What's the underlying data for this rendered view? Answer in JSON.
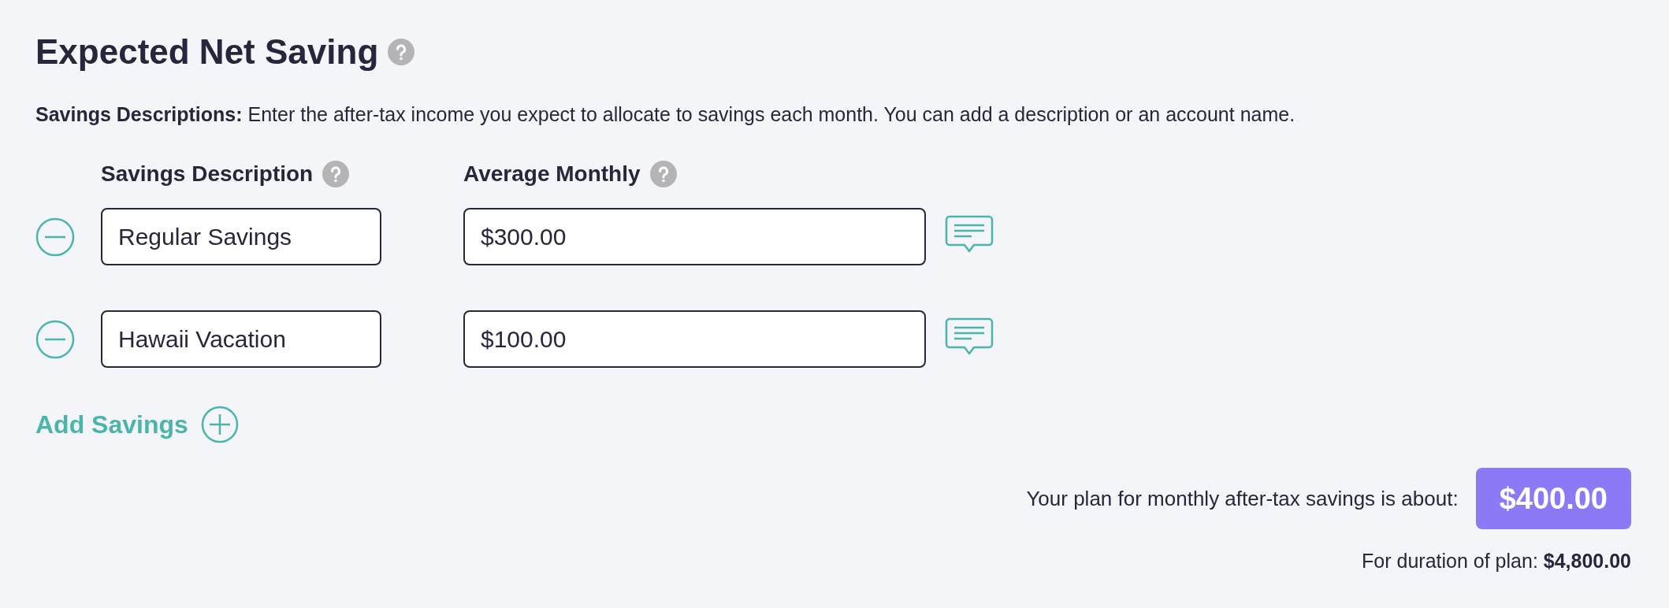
{
  "title": "Expected Net Saving",
  "description": {
    "label": "Savings Descriptions:",
    "text": "Enter the after-tax income you expect to allocate to savings each month. You can add a description or an account name."
  },
  "columns": [
    "Savings Description",
    "Average Monthly"
  ],
  "rows": [
    {
      "description": "Regular Savings",
      "amount": "$300.00"
    },
    {
      "description": "Hawaii Vacation",
      "amount": "$100.00"
    }
  ],
  "add_label": "Add Savings",
  "summary": {
    "label": "Your plan for monthly after-tax savings is about:",
    "total": "$400.00",
    "duration_label": "For duration of plan:",
    "duration_total": "$4,800.00"
  }
}
